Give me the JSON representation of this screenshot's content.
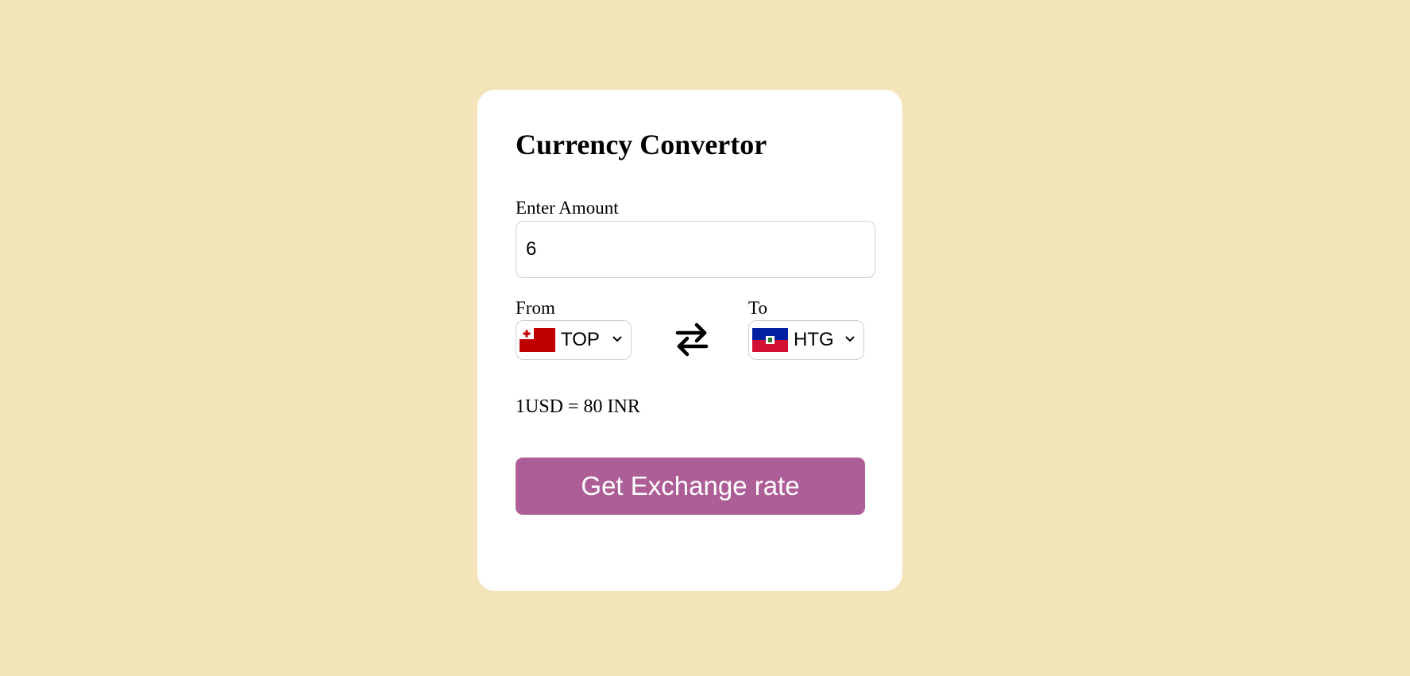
{
  "converter": {
    "title": "Currency Convertor",
    "amount_label": "Enter Amount",
    "amount_value": "6",
    "from_label": "From",
    "to_label": "To",
    "from_currency": {
      "code": "TOP",
      "flag_icon": "tonga-flag-icon"
    },
    "to_currency": {
      "code": "HTG",
      "flag_icon": "haiti-flag-icon"
    },
    "swap_icon": "swap-arrows-icon",
    "rate_text": "1USD = 80 INR",
    "button_label": "Get Exchange rate"
  },
  "colors": {
    "page_background": "#f3e4b9",
    "card_background": "#ffffff",
    "button_background": "#ae5e96",
    "button_text": "#ffffff"
  }
}
